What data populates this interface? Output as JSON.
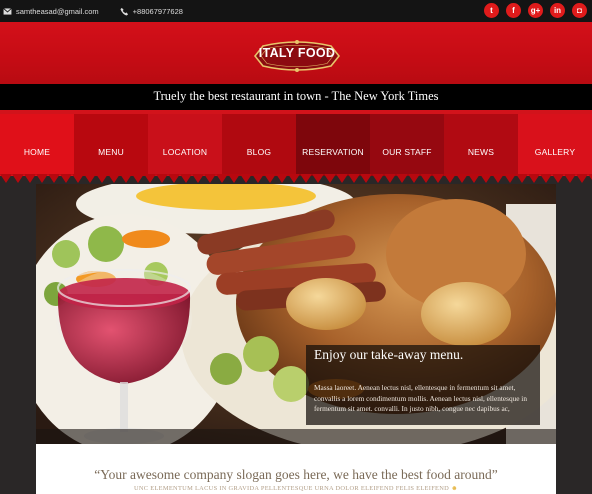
{
  "topbar": {
    "email": "samtheasad@gmail.com",
    "phone": "+88067977628",
    "socials": [
      {
        "icon": "twitter-icon",
        "glyph": "t"
      },
      {
        "icon": "facebook-icon",
        "glyph": "f"
      },
      {
        "icon": "google-plus-icon",
        "glyph": "g+"
      },
      {
        "icon": "linkedin-icon",
        "glyph": "in"
      },
      {
        "icon": "instagram-icon",
        "glyph": "◘"
      }
    ]
  },
  "brand": {
    "logo_text": "ITALY FOOD"
  },
  "tagline": "Truely the best restaurant in town - The New York Times",
  "nav": {
    "items": [
      "HOME",
      "MENU",
      "LOCATION",
      "BLOG",
      "RESERVATION",
      "OUR STAFF",
      "NEWS",
      "GALLERY"
    ],
    "colors": [
      "#e01019",
      "#b8080f",
      "#c9101a",
      "#b00910",
      "#7e060c",
      "#960810",
      "#b10a12",
      "#d9111b"
    ]
  },
  "hero": {
    "title": "Enjoy our take-away menu.",
    "body": "Massa laoreet. Aenean lectus nisl, ellentesque in fermentum sit amet, convallis a lorem condimentum mollis. Aenean lectus nisl, ellentesque in fermentum sit amet. convalli. In justo nibh, congue nec dapibus ac,"
  },
  "slogan": {
    "title": "“Your awesome company slogan goes here, we have the best food around”",
    "subtitle": "UNC ELEMENTUM LACUS IN GRAVIDA PELLENTESQUE URNA DOLOR ELEIFEND FELIS ELEIFEND",
    "emoji": "☻"
  }
}
